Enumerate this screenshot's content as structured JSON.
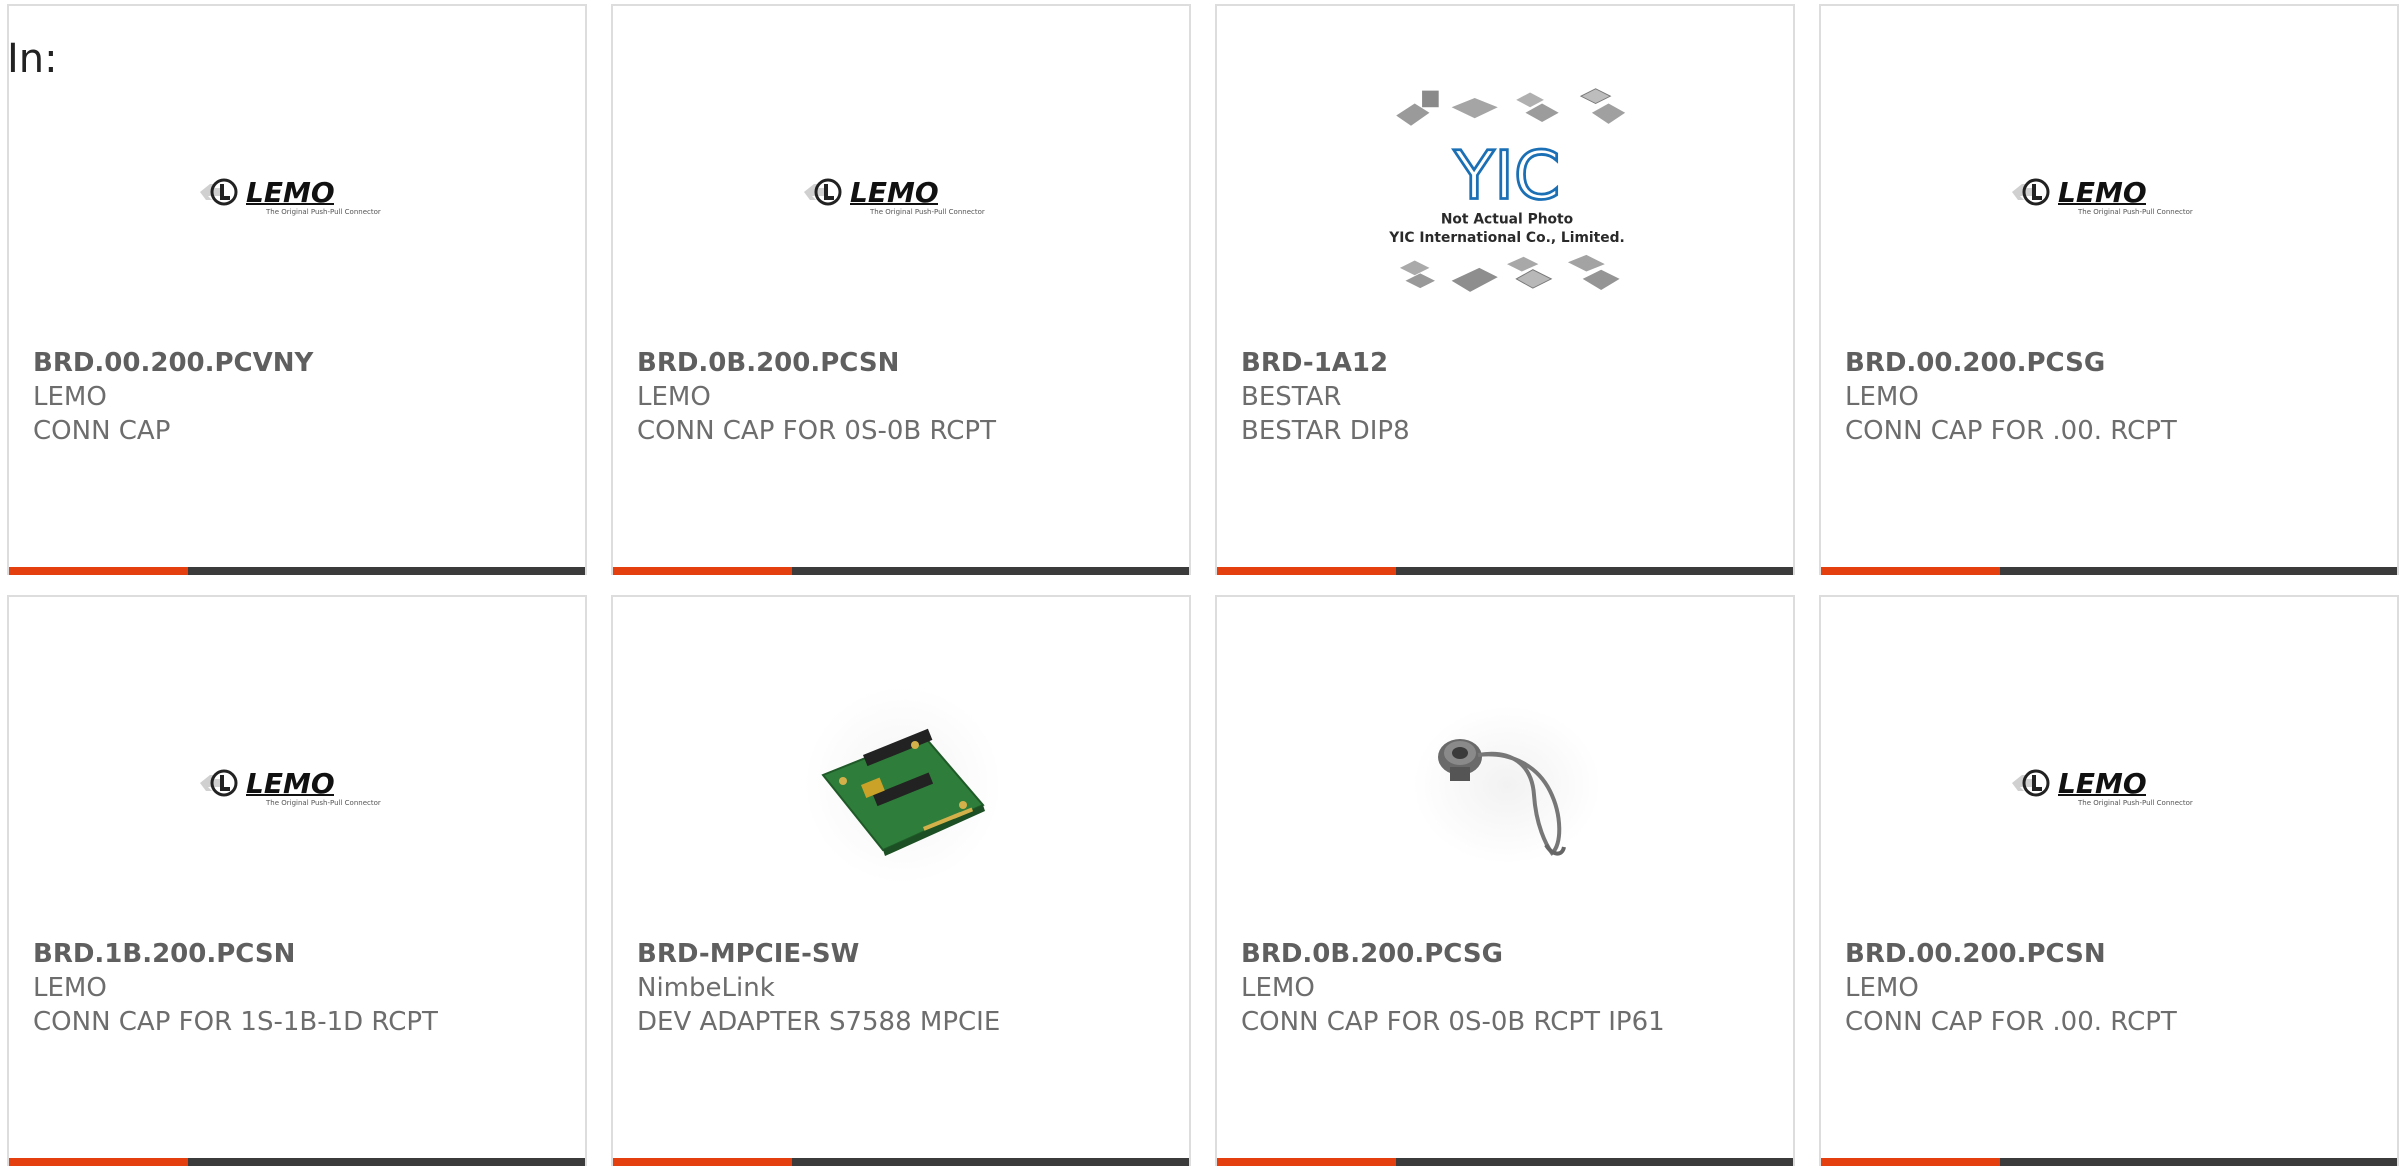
{
  "header": {
    "label": "In:"
  },
  "colors": {
    "accent": "#e4400f",
    "bar": "#3b3b3b",
    "border": "#dddddd",
    "text": "#6d6d6d"
  },
  "products": [
    {
      "part_number": "BRD.00.200.PCVNY",
      "manufacturer": "LEMO",
      "description": "CONN CAP",
      "image": "lemo-logo"
    },
    {
      "part_number": "BRD.0B.200.PCSN",
      "manufacturer": "LEMO",
      "description": "CONN CAP FOR 0S-0B RCPT",
      "image": "lemo-logo"
    },
    {
      "part_number": "BRD-1A12",
      "manufacturer": "BESTAR",
      "description": "BESTAR DIP8",
      "image": "yic-placeholder",
      "image_text": {
        "logo": "YIC",
        "line1": "Not Actual Photo",
        "line2": "YIC International Co., Limited."
      }
    },
    {
      "part_number": "BRD.00.200.PCSG",
      "manufacturer": "LEMO",
      "description": "CONN CAP FOR .00. RCPT",
      "image": "lemo-logo"
    },
    {
      "part_number": "BRD.1B.200.PCSN",
      "manufacturer": "LEMO",
      "description": "CONN CAP FOR 1S-1B-1D RCPT",
      "image": "lemo-logo"
    },
    {
      "part_number": "BRD-MPCIE-SW",
      "manufacturer": "NimbeLink",
      "description": "DEV ADAPTER S7588 MPCIE",
      "image": "circuit-board-photo"
    },
    {
      "part_number": "BRD.0B.200.PCSG",
      "manufacturer": "LEMO",
      "description": "CONN CAP FOR 0S-0B RCPT IP61",
      "image": "connector-cap-photo"
    },
    {
      "part_number": "BRD.00.200.PCSN",
      "manufacturer": "LEMO",
      "description": "CONN CAP FOR .00. RCPT",
      "image": "lemo-logo"
    }
  ]
}
